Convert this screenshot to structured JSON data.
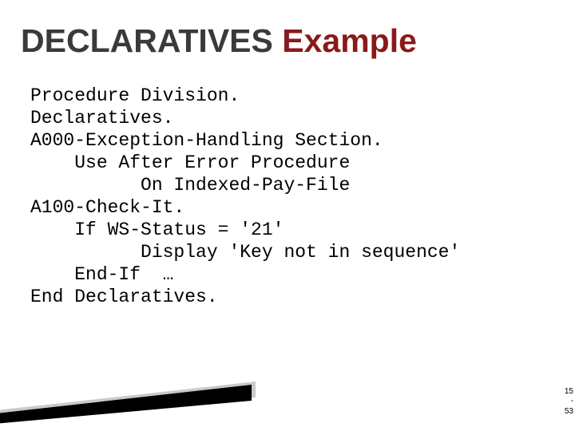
{
  "title": {
    "plain": "DECLARATIVES ",
    "accent": "Example"
  },
  "code": {
    "l1": "Procedure Division.",
    "l2": "Declaratives.",
    "l3": "A000-Exception-Handling Section.",
    "l4": "    Use After Error Procedure",
    "l5": "          On Indexed-Pay-File",
    "l6": "A100-Check-It.",
    "l7": "    If WS-Status = '21'",
    "l8": "          Display 'Key not in sequence'",
    "l9": "    End-If  …",
    "l10": "End Declaratives."
  },
  "page": {
    "top": "15",
    "mid": "-",
    "bot": "53"
  }
}
